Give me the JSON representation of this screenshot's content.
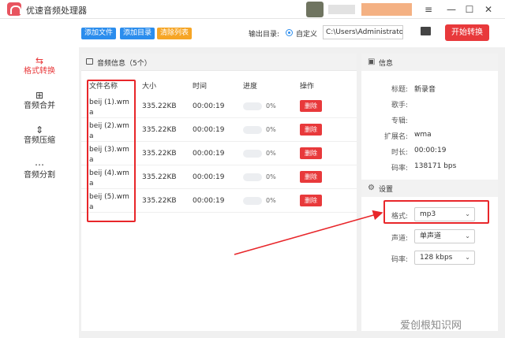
{
  "app": {
    "title": "优速音频处理器"
  },
  "window": {
    "menu_icon": "≡",
    "minimize_icon": "—",
    "maximize_icon": "☐",
    "close_icon": "✕"
  },
  "sidebar": {
    "items": [
      {
        "label": "格式转换",
        "icon": "⇆",
        "active": true
      },
      {
        "label": "音频合并",
        "icon": "⊞",
        "active": false
      },
      {
        "label": "音频压缩",
        "icon": "⇕",
        "active": false
      },
      {
        "label": "音频分割",
        "icon": "⋯",
        "active": false
      }
    ]
  },
  "toolbar": {
    "add_file": "添加文件",
    "add_dir": "添加目录",
    "clear_list": "清除列表",
    "output_label": "输出目录:",
    "custom_label": "自定义",
    "path_value": "C:\\Users\\Administrator\\",
    "convert_label": "开始转换"
  },
  "file_panel": {
    "title": "音频信息（5个）",
    "columns": [
      "文件名称",
      "大小",
      "时间",
      "进度",
      "操作"
    ],
    "rows": [
      {
        "name": "beij (1).wma",
        "size": "335.22KB",
        "time": "00:00:19",
        "progress": "0%",
        "action": "删除"
      },
      {
        "name": "beij (2).wma",
        "size": "335.22KB",
        "time": "00:00:19",
        "progress": "0%",
        "action": "删除"
      },
      {
        "name": "beij (3).wma",
        "size": "335.22KB",
        "time": "00:00:19",
        "progress": "0%",
        "action": "删除"
      },
      {
        "name": "beij (4).wma",
        "size": "335.22KB",
        "time": "00:00:19",
        "progress": "0%",
        "action": "删除"
      },
      {
        "name": "beij (5).wma",
        "size": "335.22KB",
        "time": "00:00:19",
        "progress": "0%",
        "action": "删除"
      }
    ]
  },
  "info_panel": {
    "title": "信息",
    "fields": [
      {
        "label": "标题:",
        "value": "新录音"
      },
      {
        "label": "歌手:",
        "value": ""
      },
      {
        "label": "专辑:",
        "value": ""
      },
      {
        "label": "扩展名:",
        "value": "wma"
      },
      {
        "label": "时长:",
        "value": "00:00:19"
      },
      {
        "label": "码率:",
        "value": "138171 bps"
      }
    ]
  },
  "settings_panel": {
    "title": "设置",
    "format_label": "格式:",
    "format_value": "mp3",
    "channel_label": "声道:",
    "channel_value": "单声道",
    "bitrate_label": "码率:",
    "bitrate_value": "128 kbps"
  },
  "watermark": "爱创根知识网",
  "colors": {
    "accent": "#e8393b",
    "blue": "#2b8ded",
    "orange": "#f6a525",
    "annotation_red": "#e8262a"
  }
}
